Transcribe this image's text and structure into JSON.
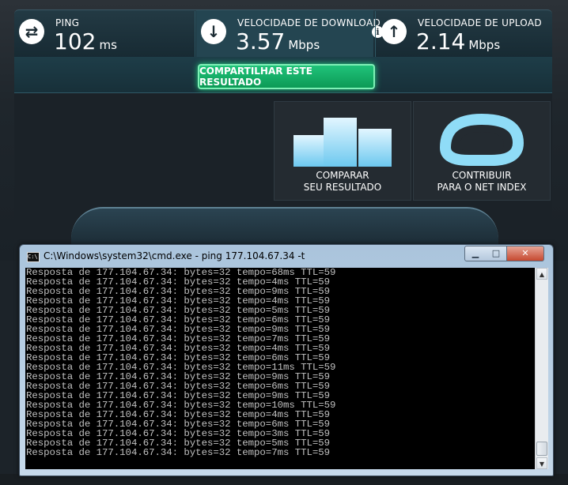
{
  "speedtest": {
    "ping": {
      "label": "PING",
      "value": "102",
      "unit": "ms",
      "icon": "transfer-arrows-icon"
    },
    "download": {
      "label": "VELOCIDADE DE DOWNLOAD",
      "value": "3.57",
      "unit": "Mbps",
      "icon": "arrow-down-icon"
    },
    "upload": {
      "label": "VELOCIDADE DE UPLOAD",
      "value": "2.14",
      "unit": "Mbps",
      "icon": "arrow-up-icon"
    },
    "info_glyph": "i",
    "share_label": "COMPARTILHAR ESTE RESULTADO",
    "compare": {
      "line1": "COMPARAR",
      "line2": "SEU RESULTADO"
    },
    "contribute": {
      "line1": "CONTRIBUIR",
      "line2": "PARA O NET INDEX"
    },
    "accent": "#21d283"
  },
  "cmd": {
    "title": "C:\\Windows\\system32\\cmd.exe - ping  177.104.67.34 -t",
    "icon_text": "C:\\",
    "buttons": {
      "minimize": "▁",
      "maximize": "□",
      "close": "✕"
    },
    "lines": [
      "Resposta de 177.104.67.34: bytes=32 tempo=68ms TTL=59",
      "Resposta de 177.104.67.34: bytes=32 tempo=4ms TTL=59",
      "Resposta de 177.104.67.34: bytes=32 tempo=9ms TTL=59",
      "Resposta de 177.104.67.34: bytes=32 tempo=4ms TTL=59",
      "Resposta de 177.104.67.34: bytes=32 tempo=5ms TTL=59",
      "Resposta de 177.104.67.34: bytes=32 tempo=6ms TTL=59",
      "Resposta de 177.104.67.34: bytes=32 tempo=9ms TTL=59",
      "Resposta de 177.104.67.34: bytes=32 tempo=7ms TTL=59",
      "Resposta de 177.104.67.34: bytes=32 tempo=4ms TTL=59",
      "Resposta de 177.104.67.34: bytes=32 tempo=6ms TTL=59",
      "Resposta de 177.104.67.34: bytes=32 tempo=11ms TTL=59",
      "Resposta de 177.104.67.34: bytes=32 tempo=9ms TTL=59",
      "Resposta de 177.104.67.34: bytes=32 tempo=6ms TTL=59",
      "Resposta de 177.104.67.34: bytes=32 tempo=9ms TTL=59",
      "Resposta de 177.104.67.34: bytes=32 tempo=10ms TTL=59",
      "Resposta de 177.104.67.34: bytes=32 tempo=4ms TTL=59",
      "Resposta de 177.104.67.34: bytes=32 tempo=6ms TTL=59",
      "Resposta de 177.104.67.34: bytes=32 tempo=3ms TTL=59",
      "Resposta de 177.104.67.34: bytes=32 tempo=5ms TTL=59",
      "Resposta de 177.104.67.34: bytes=32 tempo=7ms TTL=59"
    ]
  }
}
